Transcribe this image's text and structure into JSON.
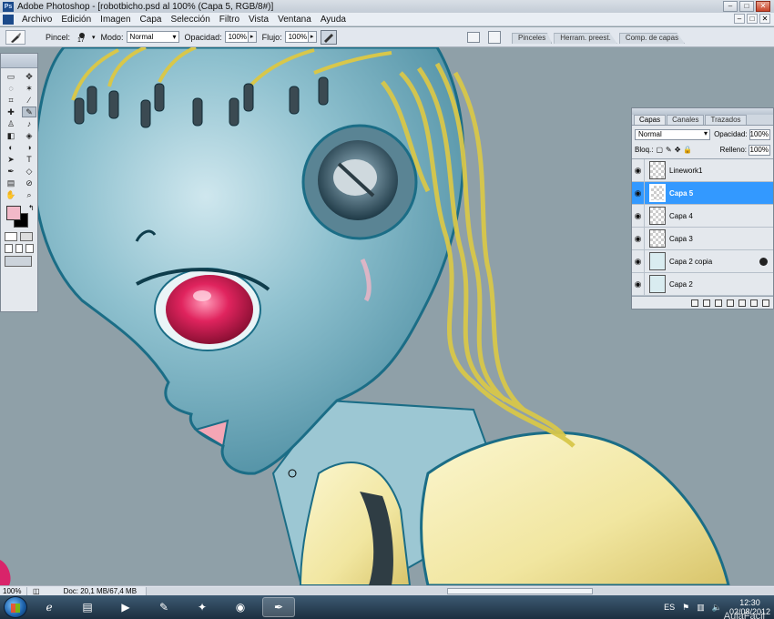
{
  "window": {
    "title": "Adobe Photoshop - [robotbicho.psd al 100% (Capa 5, RGB/8#)]",
    "minimize": "–",
    "maximize": "□",
    "close": "✕"
  },
  "menu": [
    "Archivo",
    "Edición",
    "Imagen",
    "Capa",
    "Selección",
    "Filtro",
    "Vista",
    "Ventana",
    "Ayuda"
  ],
  "options": {
    "brush_label": "Pincel:",
    "brush_size": "17",
    "mode_label": "Modo:",
    "mode_value": "Normal",
    "opacity_label": "Opacidad:",
    "opacity_value": "100%",
    "flow_label": "Flujo:",
    "flow_value": "100%",
    "well_tabs": [
      "Pinceles",
      "Herram. preest.",
      "Comp. de capas"
    ]
  },
  "layers_panel": {
    "tabs": [
      "Capas",
      "Canales",
      "Trazados"
    ],
    "blend_mode": "Normal",
    "opacity_label": "Opacidad:",
    "opacity_value": "100%",
    "lock_label": "Bloq.:",
    "fill_label": "Relleno:",
    "fill_value": "100%",
    "layers": [
      {
        "name": "Linework1",
        "visible": true,
        "selected": false
      },
      {
        "name": "Capa 5",
        "visible": true,
        "selected": true
      },
      {
        "name": "Capa 4",
        "visible": true,
        "selected": false
      },
      {
        "name": "Capa 3",
        "visible": true,
        "selected": false
      },
      {
        "name": "Capa 2 copia",
        "visible": true,
        "selected": false,
        "fx": true
      },
      {
        "name": "Capa 2",
        "visible": true,
        "selected": false
      }
    ]
  },
  "status": {
    "zoom": "100%",
    "doc": "Doc: 20,1 MB/67,4 MB"
  },
  "taskbar": {
    "lang": "ES",
    "time": "12:30",
    "date": "02/08/2012"
  },
  "watermark": "AulaFacil",
  "colors": {
    "foreground": "#f2b9c8",
    "background": "#000000",
    "canvas_bg": "#8fa0a8",
    "selection": "#3399ff"
  }
}
